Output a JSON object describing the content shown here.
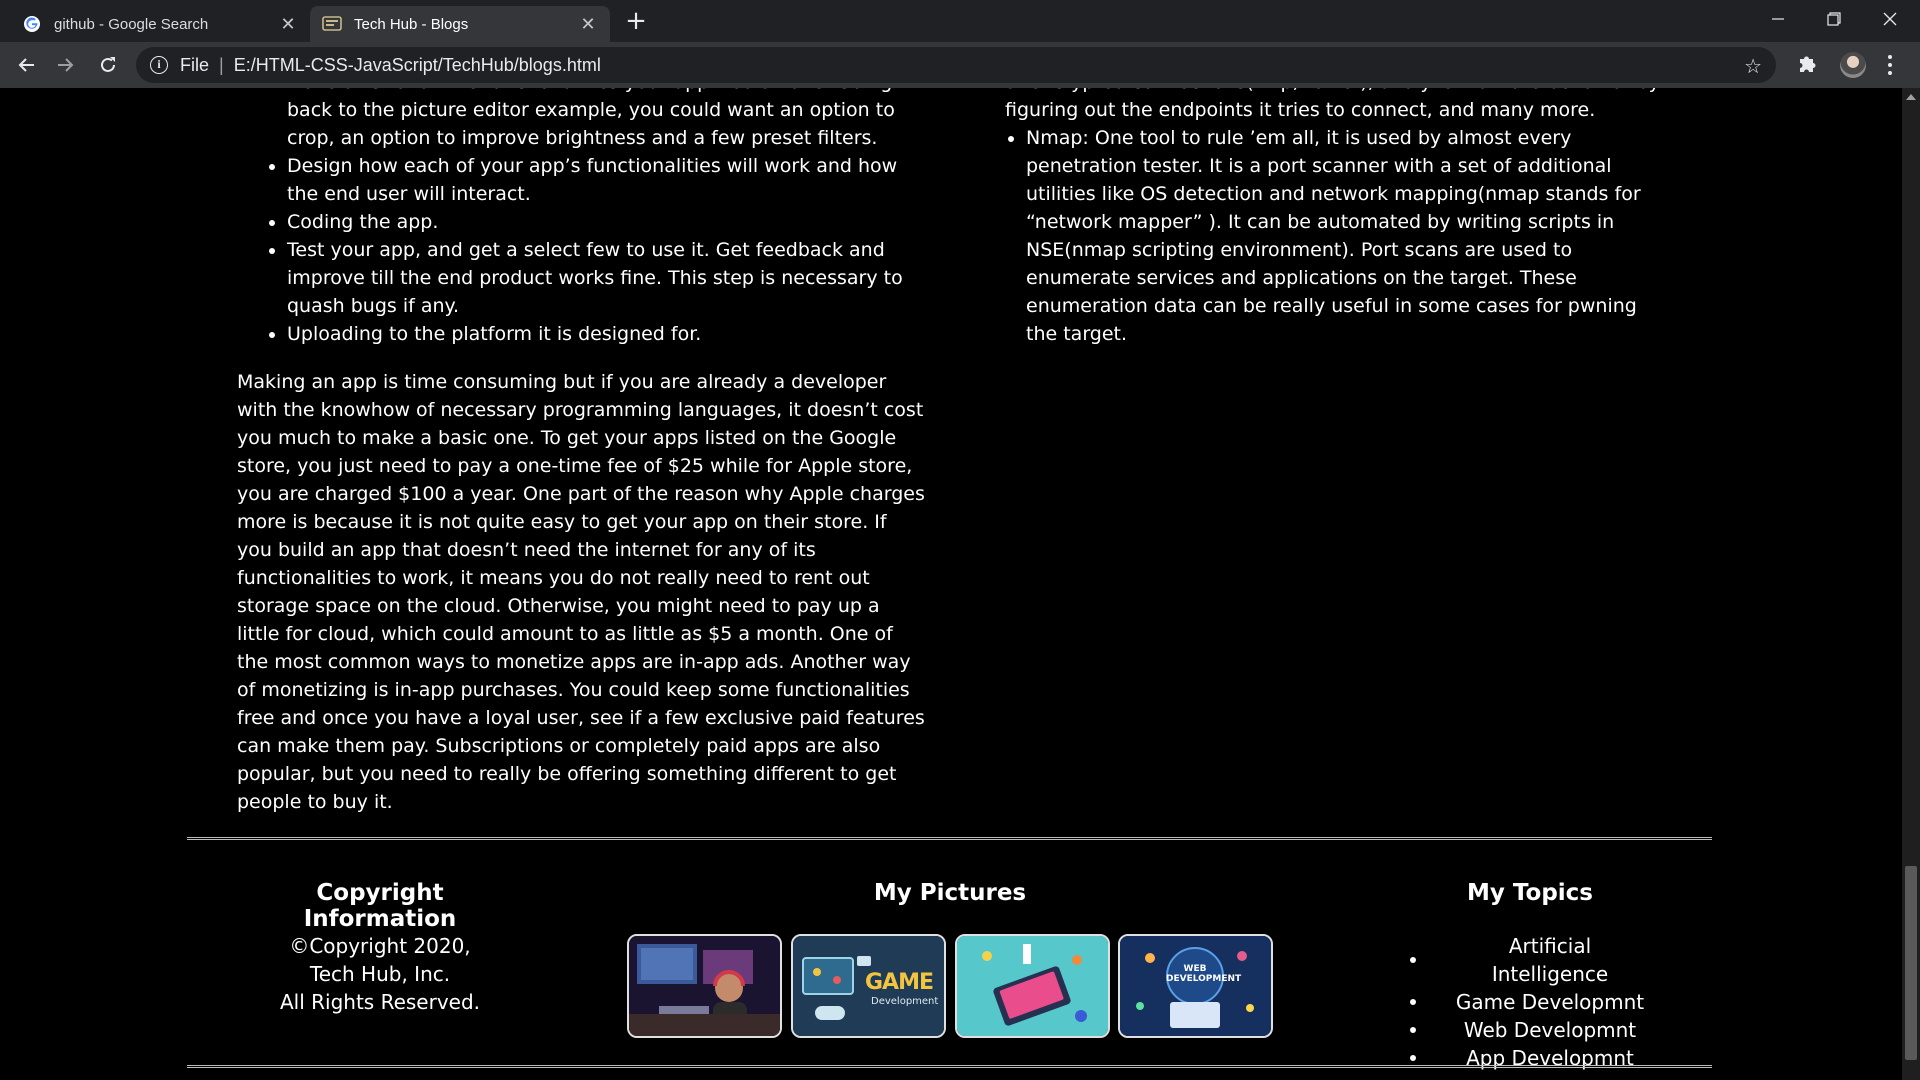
{
  "browser": {
    "tabs": [
      {
        "title": "github - Google Search",
        "active": false,
        "favicon": "google-g-icon"
      },
      {
        "title": "Tech Hub - Blogs",
        "active": true,
        "favicon": "page-icon"
      }
    ],
    "address": {
      "scheme": "File",
      "url": "E:/HTML-CSS-JavaScript/TechHub/blogs.html"
    }
  },
  "left_column": {
    "list_items": [
      "Make a list of all the functionalities your app would have. Going back to the picture editor example, you could want an option to crop, an option to improve brightness and a few preset filters.",
      "Design how each of your app’s functionalities will work and how the end user will interact.",
      "Coding the app.",
      "Test your app, and get a select few to use it. Get feedback and improve till the end product works fine. This step is necessary to quash bugs if any.",
      "Uploading to the platform it is designed for."
    ],
    "paragraph": "Making an app is time consuming but if you are already a developer with the knowhow of necessary programming languages, it doesn’t cost you much to make a basic one. To get your apps listed on the Google store, you just need to pay a one-time fee of $25 while for Apple store, you are charged $100 a year. One part of the reason why Apple charges more is because it is not quite easy to get your app on their store. If you build an app that doesn’t need the internet for any of its functionalities to work, it means you do not really need to rent out storage space on the cloud. Otherwise, you might need to pay up a little for cloud, which could amount to as little as $5 a month. One of the most common ways to monetize apps are in-app ads. Another way of monetizing is in-app purchases. You could keep some functionalities free and once you have a loyal user, see if a few exclusive paid features can make them pay. Subscriptions or completely paid apps are also popular, but you need to really be offering something different to get people to buy it."
  },
  "right_column": {
    "continued_text": "unencrypted connections(http, telnet), analyze malware behavior by figuring out the endpoints it tries to connect, and many more.",
    "list_items": [
      "Nmap: One tool to rule ’em all, it is used by almost every penetration tester. It is a port scanner with a set of additional utilities like OS detection and network mapping(nmap stands for “network mapper” ). It can be automated by writing scripts in NSE(nmap scripting environment). Port scans are used to enumerate services and applications on the target. These enumeration data can be really useful in some cases for pwning the target."
    ]
  },
  "footer": {
    "copyright": {
      "heading": "Copyright Information",
      "line1": "©Copyright 2020,",
      "line2": "Tech Hub, Inc.",
      "line3": "All Rights Reserved."
    },
    "pictures": {
      "heading": "My Pictures",
      "items": [
        "gamer-photo",
        "game-development-graphic",
        "app-development-graphic",
        "web-development-graphic"
      ]
    },
    "topics": {
      "heading": "My Topics",
      "items": [
        "Artificial Intelligence",
        "Game Developmnt",
        "Web Developmnt",
        "App Developmnt"
      ]
    }
  },
  "picture_texts": {
    "game": "GAME",
    "game_sub": "Development",
    "web": "WEB DEVELOPMENT"
  }
}
